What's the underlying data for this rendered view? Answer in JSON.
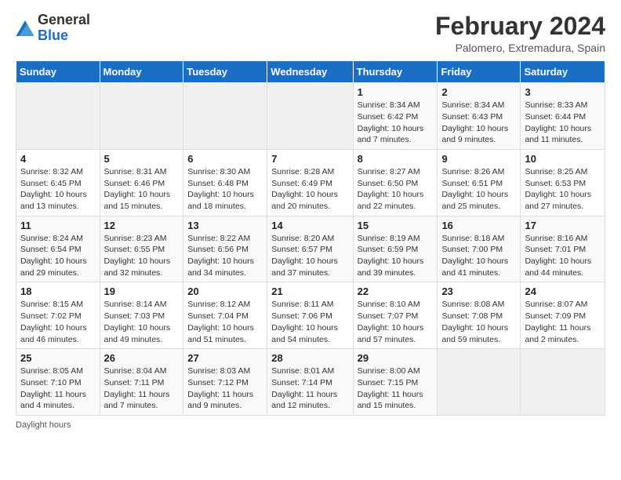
{
  "header": {
    "logo_general": "General",
    "logo_blue": "Blue",
    "main_title": "February 2024",
    "subtitle": "Palomero, Extremadura, Spain"
  },
  "calendar": {
    "days": [
      "Sunday",
      "Monday",
      "Tuesday",
      "Wednesday",
      "Thursday",
      "Friday",
      "Saturday"
    ],
    "weeks": [
      [
        {
          "date": "",
          "text": ""
        },
        {
          "date": "",
          "text": ""
        },
        {
          "date": "",
          "text": ""
        },
        {
          "date": "",
          "text": ""
        },
        {
          "date": "1",
          "text": "Sunrise: 8:34 AM\nSunset: 6:42 PM\nDaylight: 10 hours and 7 minutes."
        },
        {
          "date": "2",
          "text": "Sunrise: 8:34 AM\nSunset: 6:43 PM\nDaylight: 10 hours and 9 minutes."
        },
        {
          "date": "3",
          "text": "Sunrise: 8:33 AM\nSunset: 6:44 PM\nDaylight: 10 hours and 11 minutes."
        }
      ],
      [
        {
          "date": "4",
          "text": "Sunrise: 8:32 AM\nSunset: 6:45 PM\nDaylight: 10 hours and 13 minutes."
        },
        {
          "date": "5",
          "text": "Sunrise: 8:31 AM\nSunset: 6:46 PM\nDaylight: 10 hours and 15 minutes."
        },
        {
          "date": "6",
          "text": "Sunrise: 8:30 AM\nSunset: 6:48 PM\nDaylight: 10 hours and 18 minutes."
        },
        {
          "date": "7",
          "text": "Sunrise: 8:28 AM\nSunset: 6:49 PM\nDaylight: 10 hours and 20 minutes."
        },
        {
          "date": "8",
          "text": "Sunrise: 8:27 AM\nSunset: 6:50 PM\nDaylight: 10 hours and 22 minutes."
        },
        {
          "date": "9",
          "text": "Sunrise: 8:26 AM\nSunset: 6:51 PM\nDaylight: 10 hours and 25 minutes."
        },
        {
          "date": "10",
          "text": "Sunrise: 8:25 AM\nSunset: 6:53 PM\nDaylight: 10 hours and 27 minutes."
        }
      ],
      [
        {
          "date": "11",
          "text": "Sunrise: 8:24 AM\nSunset: 6:54 PM\nDaylight: 10 hours and 29 minutes."
        },
        {
          "date": "12",
          "text": "Sunrise: 8:23 AM\nSunset: 6:55 PM\nDaylight: 10 hours and 32 minutes."
        },
        {
          "date": "13",
          "text": "Sunrise: 8:22 AM\nSunset: 6:56 PM\nDaylight: 10 hours and 34 minutes."
        },
        {
          "date": "14",
          "text": "Sunrise: 8:20 AM\nSunset: 6:57 PM\nDaylight: 10 hours and 37 minutes."
        },
        {
          "date": "15",
          "text": "Sunrise: 8:19 AM\nSunset: 6:59 PM\nDaylight: 10 hours and 39 minutes."
        },
        {
          "date": "16",
          "text": "Sunrise: 8:18 AM\nSunset: 7:00 PM\nDaylight: 10 hours and 41 minutes."
        },
        {
          "date": "17",
          "text": "Sunrise: 8:16 AM\nSunset: 7:01 PM\nDaylight: 10 hours and 44 minutes."
        }
      ],
      [
        {
          "date": "18",
          "text": "Sunrise: 8:15 AM\nSunset: 7:02 PM\nDaylight: 10 hours and 46 minutes."
        },
        {
          "date": "19",
          "text": "Sunrise: 8:14 AM\nSunset: 7:03 PM\nDaylight: 10 hours and 49 minutes."
        },
        {
          "date": "20",
          "text": "Sunrise: 8:12 AM\nSunset: 7:04 PM\nDaylight: 10 hours and 51 minutes."
        },
        {
          "date": "21",
          "text": "Sunrise: 8:11 AM\nSunset: 7:06 PM\nDaylight: 10 hours and 54 minutes."
        },
        {
          "date": "22",
          "text": "Sunrise: 8:10 AM\nSunset: 7:07 PM\nDaylight: 10 hours and 57 minutes."
        },
        {
          "date": "23",
          "text": "Sunrise: 8:08 AM\nSunset: 7:08 PM\nDaylight: 10 hours and 59 minutes."
        },
        {
          "date": "24",
          "text": "Sunrise: 8:07 AM\nSunset: 7:09 PM\nDaylight: 11 hours and 2 minutes."
        }
      ],
      [
        {
          "date": "25",
          "text": "Sunrise: 8:05 AM\nSunset: 7:10 PM\nDaylight: 11 hours and 4 minutes."
        },
        {
          "date": "26",
          "text": "Sunrise: 8:04 AM\nSunset: 7:11 PM\nDaylight: 11 hours and 7 minutes."
        },
        {
          "date": "27",
          "text": "Sunrise: 8:03 AM\nSunset: 7:12 PM\nDaylight: 11 hours and 9 minutes."
        },
        {
          "date": "28",
          "text": "Sunrise: 8:01 AM\nSunset: 7:14 PM\nDaylight: 11 hours and 12 minutes."
        },
        {
          "date": "29",
          "text": "Sunrise: 8:00 AM\nSunset: 7:15 PM\nDaylight: 11 hours and 15 minutes."
        },
        {
          "date": "",
          "text": ""
        },
        {
          "date": "",
          "text": ""
        }
      ]
    ]
  },
  "footer": {
    "note": "Daylight hours"
  }
}
